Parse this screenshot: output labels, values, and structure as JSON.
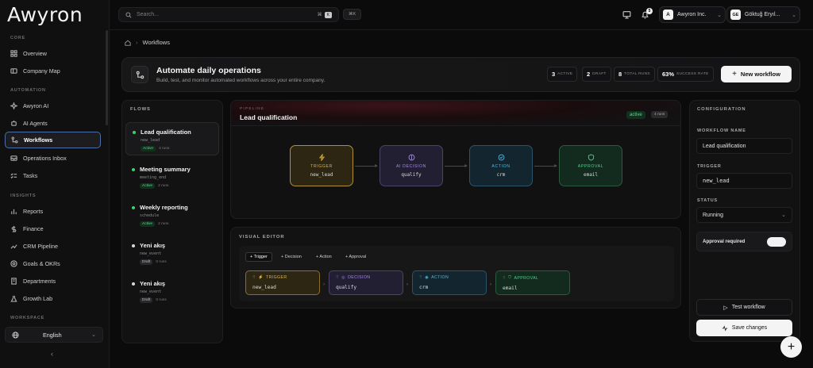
{
  "app": {
    "logo": "Awyron"
  },
  "sidebar": {
    "sections": [
      "CORE",
      "AUTOMATION",
      "INSIGHTS",
      "WORKSPACE"
    ],
    "items": [
      {
        "label": "Overview",
        "icon": "grid-icon"
      },
      {
        "label": "Company Map",
        "icon": "map-icon"
      },
      {
        "label": "Awyron AI",
        "icon": "sparkles-icon"
      },
      {
        "label": "AI Agents",
        "icon": "bot-icon"
      },
      {
        "label": "Workflows",
        "icon": "workflow-icon",
        "active": true
      },
      {
        "label": "Operations Inbox",
        "icon": "inbox-icon"
      },
      {
        "label": "Tasks",
        "icon": "checklist-icon"
      },
      {
        "label": "Reports",
        "icon": "bar-chart-icon"
      },
      {
        "label": "Finance",
        "icon": "dollar-icon"
      },
      {
        "label": "CRM Pipeline",
        "icon": "trend-icon"
      },
      {
        "label": "Goals & OKRs",
        "icon": "target-icon"
      },
      {
        "label": "Departments",
        "icon": "building-icon"
      },
      {
        "label": "Growth Lab",
        "icon": "flask-icon"
      }
    ],
    "language": "English"
  },
  "topbar": {
    "search_placeholder": "Search...",
    "search_kbd": "K",
    "shortcut": "⌘K",
    "notification_count": "5",
    "org_initial": "A",
    "org_name": "Awyron Inc.",
    "user_initials": "GE",
    "user_name": "Göktuğ Eryıl..."
  },
  "breadcrumb": {
    "current": "Workflows"
  },
  "hero": {
    "title": "Automate daily operations",
    "subtitle": "Build, test, and monitor automated workflows across your entire company.",
    "stats": [
      {
        "value": "3",
        "label": "ACTIVE"
      },
      {
        "value": "2",
        "label": "DRAFT"
      },
      {
        "value": "8",
        "label": "TOTAL RUNS"
      },
      {
        "value": "63%",
        "label": "SUCCESS RATE"
      }
    ],
    "new_button": "New workflow"
  },
  "flows": {
    "title": "FLOWS",
    "items": [
      {
        "name": "Lead qualification",
        "trigger": "new_lead",
        "status": "Active",
        "runs": "4 runs",
        "dot": "#3ecf72"
      },
      {
        "name": "Meeting summary",
        "trigger": "meeting_end",
        "status": "Active",
        "runs": "2 runs",
        "dot": "#3ecf72"
      },
      {
        "name": "Weekly reporting",
        "trigger": "schedule",
        "status": "Active",
        "runs": "2 runs",
        "dot": "#3ecf72"
      },
      {
        "name": "Yeni akış",
        "trigger": "new_event",
        "status": "Draft",
        "runs": "0 runs",
        "dot": "#d8d8d8"
      },
      {
        "name": "Yeni akış",
        "trigger": "new_event",
        "status": "Draft",
        "runs": "0 runs",
        "dot": "#d8d8d8"
      }
    ]
  },
  "pipeline": {
    "label": "PIPELINE",
    "title": "Lead qualification",
    "status": "active",
    "runs": "4 runs",
    "nodes": [
      {
        "label": "TRIGGER",
        "value": "new_lead",
        "color": "#e0b43a"
      },
      {
        "label": "AI DECISION",
        "value": "qualify",
        "color": "#a48ae8"
      },
      {
        "label": "ACTION",
        "value": "crm",
        "color": "#4fb8e0"
      },
      {
        "label": "APPROVAL",
        "value": "email",
        "color": "#4fd08a"
      }
    ]
  },
  "editor": {
    "title": "VISUAL EDITOR",
    "add_buttons": [
      "+ Trigger",
      "+ Decision",
      "+ Action",
      "+ Approval"
    ],
    "nodes": [
      {
        "label": "TRIGGER",
        "value": "new_lead"
      },
      {
        "label": "DECISION",
        "value": "qualify"
      },
      {
        "label": "ACTION",
        "value": "crm"
      },
      {
        "label": "APPROVAL",
        "value": "email"
      }
    ]
  },
  "config": {
    "title": "CONFIGURATION",
    "name_label": "WORKFLOW NAME",
    "name_value": "Lead qualification",
    "trigger_label": "TRIGGER",
    "trigger_value": "new_lead",
    "status_label": "STATUS",
    "status_value": "Running",
    "approval_label": "Approval required",
    "test_button": "Test workflow",
    "save_button": "Save changes"
  }
}
